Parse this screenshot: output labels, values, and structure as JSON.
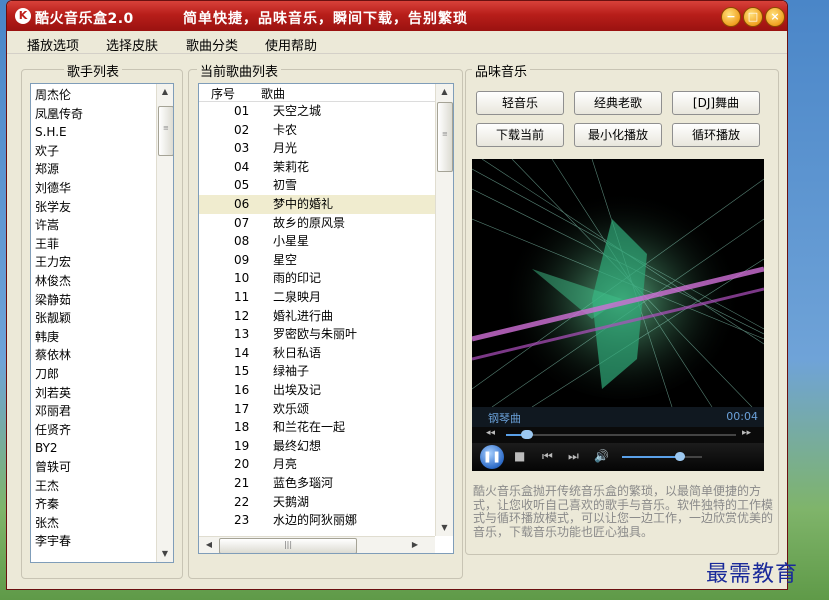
{
  "window": {
    "logo": "K",
    "title": "酷火音乐盒2.0",
    "slogan": "简单快捷，品味音乐，瞬间下载，告别繁琐",
    "controls": {
      "minimize": "−",
      "maximize": "□",
      "close": "×"
    }
  },
  "menu": [
    "播放选项",
    "选择皮肤",
    "歌曲分类",
    "使用帮助"
  ],
  "singers": {
    "title": "歌手列表",
    "items": [
      "周杰伦",
      "凤凰传奇",
      "S.H.E",
      "欢子",
      "郑源",
      "刘德华",
      "张学友",
      "许嵩",
      "王菲",
      "王力宏",
      "林俊杰",
      "梁静茹",
      "张靓颖",
      "韩庚",
      "蔡依林",
      "刀郎",
      "刘若英",
      "邓丽君",
      "任贤齐",
      "BY2",
      "曾轶可",
      "王杰",
      "齐秦",
      "张杰",
      "李宇春"
    ]
  },
  "songs": {
    "title": "当前歌曲列表",
    "col_no": "序号",
    "col_name": "歌曲",
    "selected_index": 5,
    "rows": [
      {
        "no": "01",
        "name": "天空之城"
      },
      {
        "no": "02",
        "name": "卡农"
      },
      {
        "no": "03",
        "name": "月光"
      },
      {
        "no": "04",
        "name": "茉莉花"
      },
      {
        "no": "05",
        "name": "初雪"
      },
      {
        "no": "06",
        "name": "梦中的婚礼"
      },
      {
        "no": "07",
        "name": "故乡的原风景"
      },
      {
        "no": "08",
        "name": "小星星"
      },
      {
        "no": "09",
        "name": "星空"
      },
      {
        "no": "10",
        "name": "雨的印记"
      },
      {
        "no": "11",
        "name": "二泉映月"
      },
      {
        "no": "12",
        "name": "婚礼进行曲"
      },
      {
        "no": "13",
        "name": "罗密欧与朱丽叶"
      },
      {
        "no": "14",
        "name": "秋日私语"
      },
      {
        "no": "15",
        "name": "绿袖子"
      },
      {
        "no": "16",
        "name": "出埃及记"
      },
      {
        "no": "17",
        "name": "欢乐颂"
      },
      {
        "no": "18",
        "name": "和兰花在一起"
      },
      {
        "no": "19",
        "name": "最终幻想"
      },
      {
        "no": "20",
        "name": "月亮"
      },
      {
        "no": "21",
        "name": "蓝色多瑙河"
      },
      {
        "no": "22",
        "name": "天鹅湖"
      },
      {
        "no": "23",
        "name": "水边的阿狄丽娜"
      }
    ]
  },
  "taste": {
    "title": "品味音乐",
    "buttons": [
      "轻音乐",
      "经典老歌",
      "[DJ]舞曲",
      "下载当前",
      "最小化播放",
      "循环播放"
    ]
  },
  "player": {
    "track": "钢琴曲",
    "time": "00:04",
    "seek_progress": 0.09,
    "volume_level": 0.72
  },
  "description": "酷火音乐盒抛开传统音乐盒的繁琐，以最简单便捷的方式，让您收听自己喜欢的歌手与音乐。软件独特的工作模式与循环播放模式，可以让您一边工作，一边欣赏优美的音乐，下载音乐功能也匠心独具。",
  "watermark": "最需教育"
}
